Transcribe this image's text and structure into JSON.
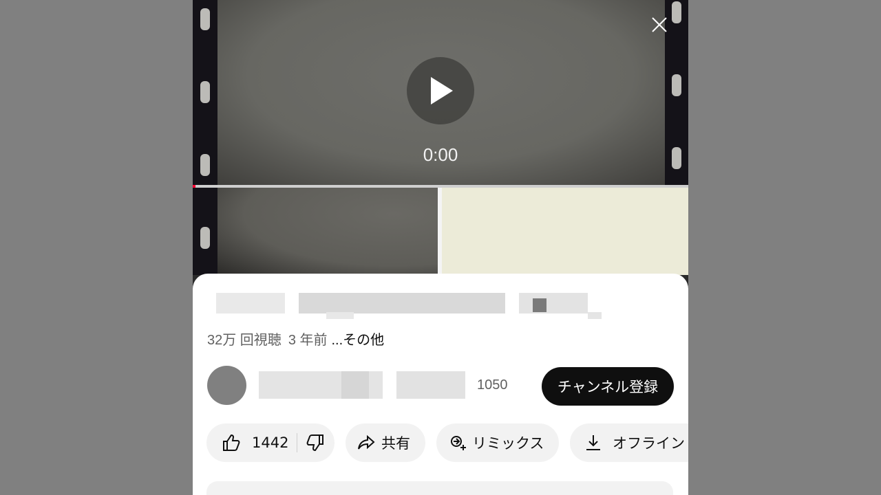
{
  "player": {
    "time": "0:00",
    "progress_fraction": 0.0
  },
  "video": {
    "views": "32万 回視聴",
    "age": "3 年前",
    "more_label": "...その他"
  },
  "channel": {
    "subscriber_count": "1050",
    "subscribe_label": "チャンネル登録"
  },
  "actions": {
    "like_count": "1442",
    "share_label": "共有",
    "remix_label": "リミックス",
    "download_label": "オフライン"
  },
  "icons": {
    "close": "close-icon",
    "play": "play-icon",
    "like": "thumbs-up-icon",
    "dislike": "thumbs-down-icon",
    "share": "share-arrow-icon",
    "remix": "remix-icon",
    "download": "download-icon"
  },
  "colors": {
    "accent_red": "#ff0033",
    "button_dark": "#0f0f0f",
    "pill_bg": "#f2f2f2"
  }
}
